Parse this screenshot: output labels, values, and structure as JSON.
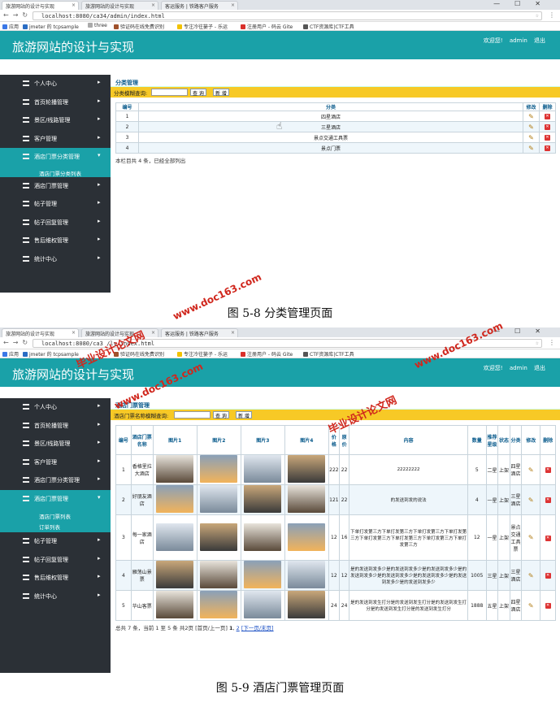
{
  "screen1": {
    "tabs": [
      "旅游网站的设计与实现",
      "旅游网站的设计与实现",
      "客运服务 | 铁路客户服务"
    ],
    "url": "localhost:8080/ca34/admin/index.html",
    "bookmarks": [
      "应用",
      "jmeter 的 tcpsample",
      "three",
      "验证码在线免费识别",
      "专注冷往篓子 - 乐运",
      "注册用户 - 码云 Gite",
      "CTF资源库|CTF工具"
    ],
    "brand": "旅游网站的设计与实现",
    "user": {
      "welcome": "欢迎您!",
      "name": "admin",
      "logout": "退出"
    },
    "sidebar": [
      {
        "label": "个人中心"
      },
      {
        "label": "首页轮播管理"
      },
      {
        "label": "景区/线路管理"
      },
      {
        "label": "客户管理"
      },
      {
        "label": "酒店门票分类管理",
        "active": true,
        "children": [
          "酒店门票分类列表"
        ]
      },
      {
        "label": "酒店门票管理"
      },
      {
        "label": "帖子管理"
      },
      {
        "label": "帖子回复管理"
      },
      {
        "label": "售后维权管理"
      },
      {
        "label": "统计中心"
      }
    ],
    "page_title": "分类管理",
    "search_label": "分类模糊查询:",
    "search_button": "查 询",
    "add_button": "新 增",
    "table": {
      "headers": [
        "编号",
        "分类",
        "修改",
        "删除"
      ],
      "rows": [
        [
          "1",
          "四星酒店"
        ],
        [
          "2",
          "三星酒店"
        ],
        [
          "3",
          "景点交通工具票"
        ],
        [
          "4",
          "景点门票"
        ]
      ]
    },
    "footnote": "本栏目共 4 条，已经全部列出",
    "caption": "图 5-8 分类管理页面"
  },
  "screen2": {
    "url": "localhost:8080/ca3",
    "url_tail": "/ly/index.html",
    "page_title": "酒店门票管理",
    "search_label": "酒店门票名称模糊查询:",
    "search_button": "查 询",
    "add_button": "新 增",
    "sidebar_active": "酒店门票管理",
    "sidebar_children": [
      "酒店门票列表",
      "订单列表"
    ],
    "table": {
      "headers": [
        "编号",
        "酒店门票名称",
        "图片1",
        "图片2",
        "图片3",
        "图片4",
        "价格",
        "原价",
        "内容",
        "数量",
        "推荐星级",
        "状态",
        "分类",
        "修改",
        "删除"
      ],
      "rows": [
        {
          "id": "1",
          "name": "香格里拉大酒店",
          "price": "222",
          "orig": "22",
          "content": "22222222",
          "qty": "5",
          "star": "二星",
          "status": "上架",
          "cat": "四星酒店"
        },
        {
          "id": "2",
          "name": "好朋友酒店",
          "price": "121",
          "orig": "22",
          "content": "的发送到发的说法",
          "qty": "4",
          "star": "一星",
          "status": "上架",
          "cat": "三星酒店"
        },
        {
          "id": "3",
          "name": "每一家酒店",
          "price": "12",
          "orig": "16",
          "content": "下单打发第三方下单打发第三方下单打发第三方下单打发第三方下单打发第三方下单打发第三方下单打发第三方下单打发第三方",
          "qty": "12",
          "star": "一星",
          "status": "上架",
          "cat": "景点交通工具票"
        },
        {
          "id": "4",
          "name": "雁荡山景票",
          "price": "12",
          "orig": "12",
          "content": "是的发送到发多少是的发送到发多少是的发送到发多少是的发送到发多少是的发送到发多少是的发送到发多少是的发送到发多少是的发送到发多少",
          "qty": "1005",
          "star": "三星",
          "status": "上架",
          "cat": "三星酒店"
        },
        {
          "id": "5",
          "name": "华山客票",
          "price": "24",
          "orig": "24",
          "content": "是的发送到发生打分是的发送到发生打分是的发送到发生打分是的发送到发生打分是的发送到发生打分",
          "qty": "1888",
          "star": "五星",
          "status": "上架",
          "cat": "四星酒店"
        }
      ]
    },
    "footnote_pre": "总共 7 条，当前 1 至 5 条 共2页",
    "pager": {
      "first_prev": "[首页/上一页]",
      "page1": "1",
      "page2": "2",
      "next_last": "[下一页/末页]"
    },
    "caption": "图 5-9 酒店门票管理页面"
  },
  "watermarks": [
    "www.doc163.com",
    "毕业设计论文网",
    "www.doc163.com",
    "毕业设计论文网",
    "www.doc163.com"
  ],
  "colors": {
    "teal": "#1aa1a8",
    "sidebar": "#2b3036",
    "searchbar": "#f7c926",
    "watermark": "#d0271d"
  }
}
